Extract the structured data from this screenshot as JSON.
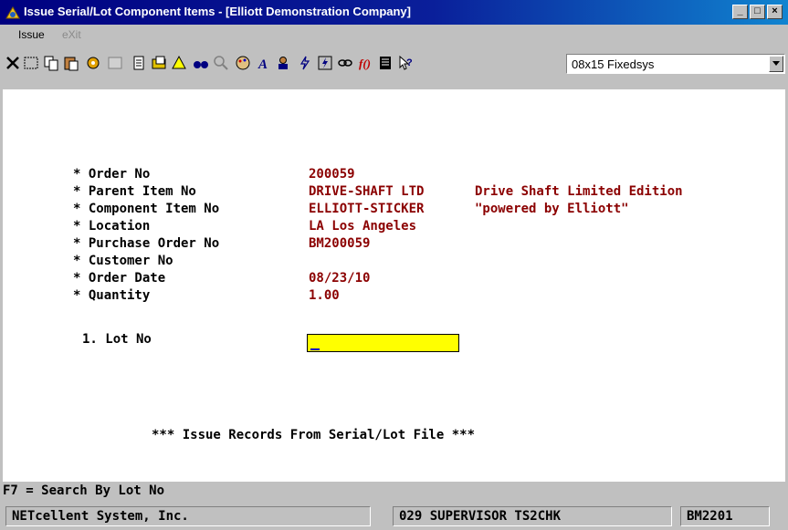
{
  "window": {
    "title": "Issue Serial/Lot Component Items - [Elliott Demonstration Company]",
    "controls": [
      "minimize",
      "maximize",
      "close"
    ]
  },
  "menu": [
    {
      "label": "Issue",
      "enabled": true
    },
    {
      "label": "eXit",
      "enabled": false
    }
  ],
  "toolbar": {
    "icons": [
      "cancel-icon",
      "select-icon",
      "copy-icon",
      "paste-icon",
      "settings-icon",
      "properties-icon",
      "notes-icon",
      "folder-icon",
      "warning-icon",
      "binoculars-icon",
      "magnify-icon",
      "palette-icon",
      "font-icon",
      "user-icon",
      "lightning-icon",
      "lightning-alt-icon",
      "link-icon",
      "function-icon",
      "document-icon",
      "help-icon"
    ],
    "font_name": "08x15 Fixedsys"
  },
  "form": {
    "fields": [
      {
        "label": "* Order No",
        "value": "200059",
        "extra": ""
      },
      {
        "label": "* Parent Item No",
        "value": "DRIVE-SHAFT LTD",
        "extra": "Drive Shaft Limited Edition"
      },
      {
        "label": "* Component Item No",
        "value": "ELLIOTT-STICKER",
        "extra": "\"powered by Elliott\""
      },
      {
        "label": "* Location",
        "value": "LA Los Angeles",
        "extra": ""
      },
      {
        "label": "* Purchase Order No",
        "value": "BM200059",
        "extra": ""
      },
      {
        "label": "* Customer No",
        "value": "",
        "extra": ""
      },
      {
        "label": "* Order Date",
        "value": "08/23/10",
        "extra": ""
      },
      {
        "label": "* Quantity",
        "value": "1.00",
        "extra": ""
      }
    ],
    "lot_label": "1. Lot No",
    "lot_value": "",
    "banner": "*** Issue Records From Serial/Lot File ***"
  },
  "hint": "F7 = Search By Lot No",
  "status": {
    "company": "NETcellent System, Inc.",
    "user": "029 SUPERVISOR TS2CHK",
    "code": "BM2201"
  }
}
